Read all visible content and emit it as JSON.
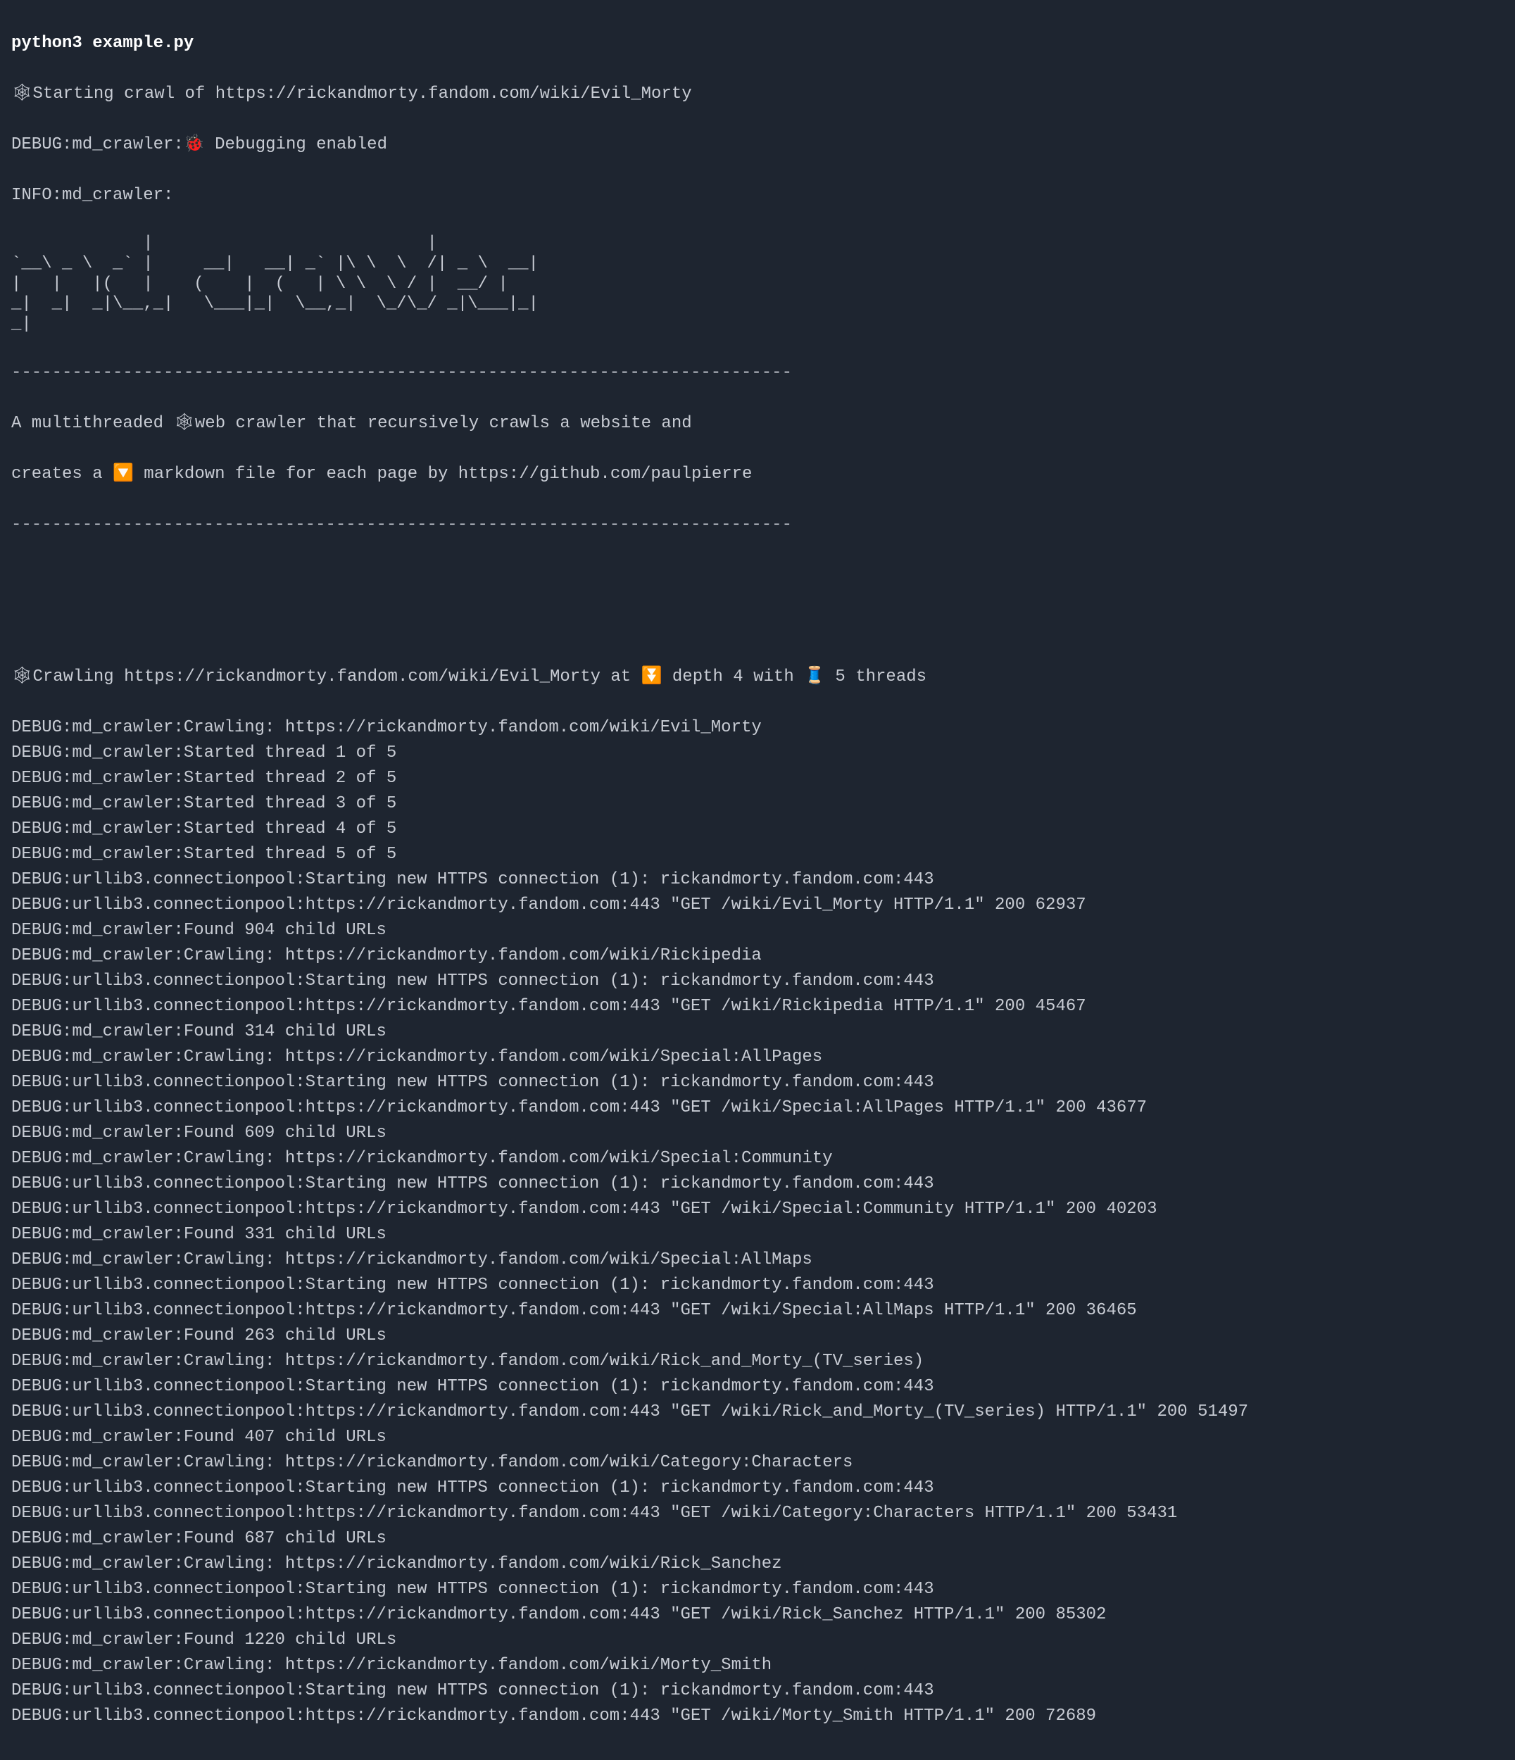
{
  "command": "python3 example.py",
  "intro": {
    "starting_line": "🕸Starting crawl of https://rickandmorty.fandom.com/wiki/Evil_Morty",
    "debug_enabled": "DEBUG:md_crawler:🐞 Debugging enabled",
    "info_header": "INFO:md_crawler:",
    "ascii_art": "             |                           |              \n`__\\ _ \\  _` |     __|   __| _` |\\ \\  \\  /| _ \\  __|\n|   |   |(   |    (    |  (   | \\ \\  \\ / |  __/ |   \n_|  _|  _|\\__,_|   \\___|_|  \\__,_|  \\_/\\_/ _|\\___|_|   \n_|    ",
    "separator": "-----------------------------------------------------------------------------",
    "description_line1": "A multithreaded 🕸web crawler that recursively crawls a website and",
    "description_line2": "creates a 🔽 markdown file for each page by https://github.com/paulpierre",
    "separator2": "-----------------------------------------------------------------------------"
  },
  "crawl_start": "🕸Crawling https://rickandmorty.fandom.com/wiki/Evil_Morty at ⏬ depth 4 with 🧵 5 threads",
  "log_lines": [
    "DEBUG:md_crawler:Crawling: https://rickandmorty.fandom.com/wiki/Evil_Morty",
    "DEBUG:md_crawler:Started thread 1 of 5",
    "DEBUG:md_crawler:Started thread 2 of 5",
    "DEBUG:md_crawler:Started thread 3 of 5",
    "DEBUG:md_crawler:Started thread 4 of 5",
    "DEBUG:md_crawler:Started thread 5 of 5",
    "DEBUG:urllib3.connectionpool:Starting new HTTPS connection (1): rickandmorty.fandom.com:443",
    "DEBUG:urllib3.connectionpool:https://rickandmorty.fandom.com:443 \"GET /wiki/Evil_Morty HTTP/1.1\" 200 62937",
    "DEBUG:md_crawler:Found 904 child URLs",
    "DEBUG:md_crawler:Crawling: https://rickandmorty.fandom.com/wiki/Rickipedia",
    "DEBUG:urllib3.connectionpool:Starting new HTTPS connection (1): rickandmorty.fandom.com:443",
    "DEBUG:urllib3.connectionpool:https://rickandmorty.fandom.com:443 \"GET /wiki/Rickipedia HTTP/1.1\" 200 45467",
    "DEBUG:md_crawler:Found 314 child URLs",
    "DEBUG:md_crawler:Crawling: https://rickandmorty.fandom.com/wiki/Special:AllPages",
    "DEBUG:urllib3.connectionpool:Starting new HTTPS connection (1): rickandmorty.fandom.com:443",
    "DEBUG:urllib3.connectionpool:https://rickandmorty.fandom.com:443 \"GET /wiki/Special:AllPages HTTP/1.1\" 200 43677",
    "DEBUG:md_crawler:Found 609 child URLs",
    "DEBUG:md_crawler:Crawling: https://rickandmorty.fandom.com/wiki/Special:Community",
    "DEBUG:urllib3.connectionpool:Starting new HTTPS connection (1): rickandmorty.fandom.com:443",
    "DEBUG:urllib3.connectionpool:https://rickandmorty.fandom.com:443 \"GET /wiki/Special:Community HTTP/1.1\" 200 40203",
    "DEBUG:md_crawler:Found 331 child URLs",
    "DEBUG:md_crawler:Crawling: https://rickandmorty.fandom.com/wiki/Special:AllMaps",
    "DEBUG:urllib3.connectionpool:Starting new HTTPS connection (1): rickandmorty.fandom.com:443",
    "DEBUG:urllib3.connectionpool:https://rickandmorty.fandom.com:443 \"GET /wiki/Special:AllMaps HTTP/1.1\" 200 36465",
    "DEBUG:md_crawler:Found 263 child URLs",
    "DEBUG:md_crawler:Crawling: https://rickandmorty.fandom.com/wiki/Rick_and_Morty_(TV_series)",
    "DEBUG:urllib3.connectionpool:Starting new HTTPS connection (1): rickandmorty.fandom.com:443",
    "DEBUG:urllib3.connectionpool:https://rickandmorty.fandom.com:443 \"GET /wiki/Rick_and_Morty_(TV_series) HTTP/1.1\" 200 51497",
    "DEBUG:md_crawler:Found 407 child URLs",
    "DEBUG:md_crawler:Crawling: https://rickandmorty.fandom.com/wiki/Category:Characters",
    "DEBUG:urllib3.connectionpool:Starting new HTTPS connection (1): rickandmorty.fandom.com:443",
    "DEBUG:urllib3.connectionpool:https://rickandmorty.fandom.com:443 \"GET /wiki/Category:Characters HTTP/1.1\" 200 53431",
    "DEBUG:md_crawler:Found 687 child URLs",
    "DEBUG:md_crawler:Crawling: https://rickandmorty.fandom.com/wiki/Rick_Sanchez",
    "DEBUG:urllib3.connectionpool:Starting new HTTPS connection (1): rickandmorty.fandom.com:443",
    "DEBUG:urllib3.connectionpool:https://rickandmorty.fandom.com:443 \"GET /wiki/Rick_Sanchez HTTP/1.1\" 200 85302",
    "DEBUG:md_crawler:Found 1220 child URLs",
    "DEBUG:md_crawler:Crawling: https://rickandmorty.fandom.com/wiki/Morty_Smith",
    "DEBUG:urllib3.connectionpool:Starting new HTTPS connection (1): rickandmorty.fandom.com:443",
    "DEBUG:urllib3.connectionpool:https://rickandmorty.fandom.com:443 \"GET /wiki/Morty_Smith HTTP/1.1\" 200 72689"
  ]
}
